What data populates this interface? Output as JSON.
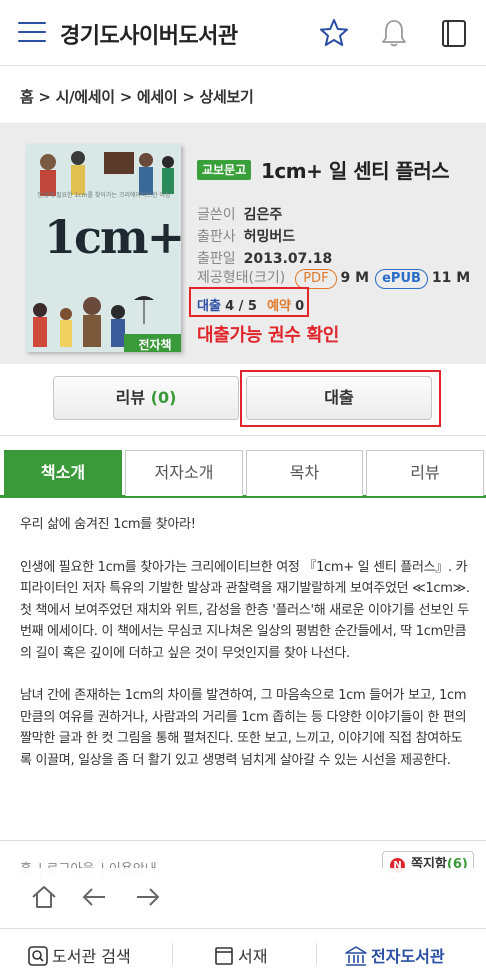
{
  "header": {
    "app_title": "경기도사이버도서관",
    "icons": [
      "menu-icon",
      "star-icon",
      "bell-icon",
      "book-icon"
    ]
  },
  "breadcrumb": {
    "text": "홈 > 시/에세이 > 에세이 > 상세보기"
  },
  "book": {
    "cover_big_text": "1cm+",
    "cover_subtitle": "인생에 필요한 1cm를 찾아가는 크리에이티브한 여정",
    "ebook_badge": "전자책",
    "publisher_badge": "교보문고",
    "title": "1cm+ 일 센티 플러스",
    "author_label": "글쓴이",
    "author": "김은주",
    "publisher_label": "출판사",
    "publisher": "허밍버드",
    "date_label": "출판일",
    "date": "2013.07.18",
    "format_label": "제공형태(크기)",
    "pdf_label": "PDF",
    "pdf_size": "9 M",
    "epub_label": "ePUB",
    "epub_size": "11 M",
    "loan_label": "대출",
    "loan_count": "4 / 5",
    "reserve_label": "예약",
    "reserve_count": "0",
    "annotation": "대출가능 권수 확인"
  },
  "actions": {
    "review_label": "리뷰",
    "review_count": "(0)",
    "loan_button": "대출"
  },
  "tabs": [
    "책소개",
    "저자소개",
    "목차",
    "리뷰"
  ],
  "active_tab": "책소개",
  "description": [
    "우리 삶에 숨겨진 1cm를 찾아라!",
    "인생에 필요한 1cm를 찾아가는 크리에이티브한 여정 『1cm+ 일 센티 플러스』. 카피라이터인 저자 특유의 기발한 발상과 관찰력을 재기발랄하게 보여주었던 ≪1cm≫. 첫 책에서 보여주었던 재치와 위트, 감성을 한층 '플러스'해 새로운 이야기를 선보인 두 번째 에세이다. 이 책에서는 무심코 지나쳐온 일상의 평범한 순간들에서, 딱 1cm만큼의 길이 혹은 깊이에 더하고 싶은 것이 무엇인지를 찾아 나선다.",
    "남녀 간에 존재하는 1cm의 차이를 발견하여, 그 마음속으로 1cm 들어가 보고, 1cm만큼의 여유를 권하거나, 사람과의 거리를 1cm 좁히는 등 다양한 이야기들이 한 편의 짤막한 글과 한 컷 그림을 통해 펼쳐진다. 또한 보고, 느끼고, 이야기에 직접 참여하도록 이끌며, 일상을 좀 더 활기 있고 생명력 넘치게 살아갈 수 있는 시선을 제공한다."
  ],
  "footer": {
    "links": [
      "홈",
      "로그아웃",
      "이용안내"
    ],
    "note_label": "쪽지함",
    "note_count": "(6)",
    "note_icon_letter": "N"
  },
  "browser_nav": [
    "home-icon",
    "back-arrow-icon",
    "forward-arrow-icon"
  ],
  "bottom_bar": {
    "search": "도서관 검색",
    "shelf": "서재",
    "ebook": "전자도서관"
  },
  "colors": {
    "accent_blue": "#2a4ea3",
    "accent_green": "#3a9a3a",
    "highlight_red": "#e0262a",
    "pdf_orange": "#e07a2a"
  }
}
